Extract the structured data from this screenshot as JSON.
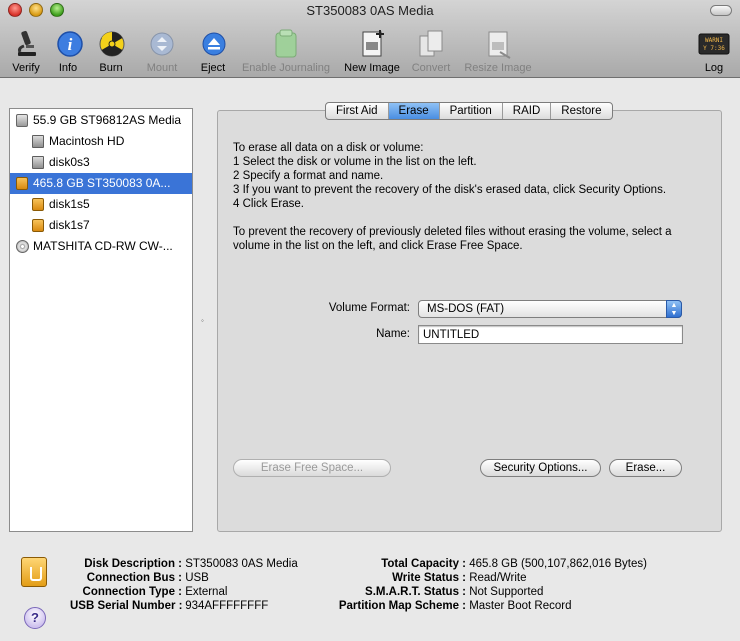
{
  "window": {
    "title": "ST350083 0AS Media"
  },
  "toolbar": [
    {
      "label": "Verify",
      "icon": "microscope-icon",
      "enabled": true
    },
    {
      "label": "Info",
      "icon": "info-icon",
      "enabled": true
    },
    {
      "label": "Burn",
      "icon": "burn-icon",
      "enabled": true
    },
    {
      "label": "Mount",
      "icon": "mount-icon",
      "enabled": false
    },
    {
      "label": "Eject",
      "icon": "eject-icon",
      "enabled": true
    },
    {
      "label": "Enable Journaling",
      "icon": "journaling-icon",
      "enabled": false
    },
    {
      "label": "New Image",
      "icon": "new-image-icon",
      "enabled": true
    },
    {
      "label": "Convert",
      "icon": "convert-icon",
      "enabled": false
    },
    {
      "label": "Resize Image",
      "icon": "resize-image-icon",
      "enabled": false
    },
    {
      "label": "Log",
      "icon": "log-icon",
      "enabled": true
    }
  ],
  "log_icon_text": {
    "line1": "WARNI",
    "line2": "Y 7:36"
  },
  "disk_list": [
    {
      "label": "55.9 GB ST96812AS Media",
      "kind": "disk",
      "indent": 0,
      "selected": false
    },
    {
      "label": "Macintosh HD",
      "kind": "volume",
      "indent": 1,
      "selected": false
    },
    {
      "label": "disk0s3",
      "kind": "volume",
      "indent": 1,
      "selected": false
    },
    {
      "label": "465.8 GB ST350083 0A...",
      "kind": "external-disk",
      "indent": 0,
      "selected": true
    },
    {
      "label": "disk1s5",
      "kind": "external-volume",
      "indent": 1,
      "selected": false
    },
    {
      "label": "disk1s7",
      "kind": "external-volume",
      "indent": 1,
      "selected": false
    },
    {
      "label": "MATSHITA CD-RW CW-...",
      "kind": "optical",
      "indent": 0,
      "selected": false
    }
  ],
  "tabs": [
    {
      "label": "First Aid",
      "active": false
    },
    {
      "label": "Erase",
      "active": true
    },
    {
      "label": "Partition",
      "active": false
    },
    {
      "label": "RAID",
      "active": false
    },
    {
      "label": "Restore",
      "active": false
    }
  ],
  "erase": {
    "instructions": [
      "To erase all data on a disk or volume:",
      "1 Select the disk or volume in the list on the left.",
      "2 Specify a format and name.",
      "3 If you want to prevent the recovery of the disk's erased data, click Security Options.",
      "4 Click Erase."
    ],
    "free_space_note_line1": "To prevent the recovery of previously deleted files without erasing the volume, select a",
    "free_space_note_line2": "volume in the list on the left, and click Erase Free Space.",
    "volume_format_label": "Volume Format:",
    "volume_format_value": "MS-DOS (FAT)",
    "name_label": "Name:",
    "name_value": "UNTITLED",
    "erase_free_space_button": "Erase Free Space...",
    "security_options_button": "Security Options...",
    "erase_button": "Erase..."
  },
  "info": {
    "disk_description_label": "Disk Description :",
    "disk_description_value": "ST350083 0AS Media",
    "connection_bus_label": "Connection Bus :",
    "connection_bus_value": "USB",
    "connection_type_label": "Connection Type :",
    "connection_type_value": "External",
    "usb_serial_label": "USB Serial Number :",
    "usb_serial_value": "934AFFFFFFFF",
    "total_capacity_label": "Total Capacity :",
    "total_capacity_value": "465.8 GB (500,107,862,016 Bytes)",
    "write_status_label": "Write Status :",
    "write_status_value": "Read/Write",
    "smart_status_label": "S.M.A.R.T. Status :",
    "smart_status_value": "Not Supported",
    "partition_map_label": "Partition Map Scheme :",
    "partition_map_value": "Master Boot Record"
  },
  "help_button": "?"
}
